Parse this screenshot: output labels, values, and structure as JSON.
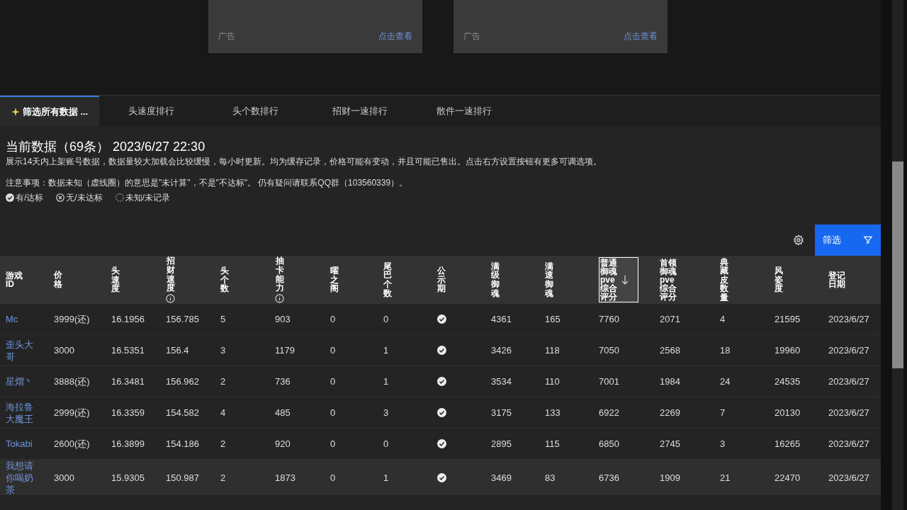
{
  "ads": [
    {
      "label": "广告",
      "link": "点击查看"
    },
    {
      "label": "广告",
      "link": "点击查看"
    }
  ],
  "tabs": [
    {
      "label": "筛选所有数据 ...",
      "selected": true,
      "icon": true
    },
    {
      "label": "头速度排行",
      "selected": false,
      "icon": false
    },
    {
      "label": "头个数排行",
      "selected": false,
      "icon": false
    },
    {
      "label": "招财一速排行",
      "selected": false,
      "icon": false
    },
    {
      "label": "散件一速排行",
      "selected": false,
      "icon": false
    }
  ],
  "heading": "当前数据（69条） 2023/6/27 22:30",
  "description": "展示14天内上架账号数据，数据量较大加载会比较缓慢，每小时更新。均为缓存记录，价格可能有变动，并且可能已售出。点击右方设置按钮有更多可调选项。",
  "notice": "注意事项：数据未知（虚线圈）的意思是\"未计算\"，不是\"不达标\"。 仍有疑问请联系QQ群（103560339）。",
  "legend": [
    {
      "kind": "yes",
      "label": "有/达标"
    },
    {
      "kind": "no",
      "label": "无/未达标"
    },
    {
      "kind": "unknown",
      "label": "未知/未记录"
    }
  ],
  "filter_button": "筛选",
  "table": {
    "columns": [
      {
        "label": "游戏ID",
        "kind": "wrapped",
        "info": false,
        "sorted": false
      },
      {
        "label": "价格",
        "kind": "stacked",
        "info": false,
        "sorted": false
      },
      {
        "label": "头速度",
        "kind": "stacked",
        "info": false,
        "sorted": false
      },
      {
        "label": "招财速度",
        "kind": "stacked",
        "info": true,
        "sorted": false
      },
      {
        "label": "头个数",
        "kind": "stacked",
        "info": false,
        "sorted": false
      },
      {
        "label": "抽卡能力",
        "kind": "stacked",
        "info": true,
        "sorted": false
      },
      {
        "label": "曜之阁",
        "kind": "stacked",
        "info": false,
        "sorted": false
      },
      {
        "label": "尾巴个数",
        "kind": "stacked",
        "info": false,
        "sorted": false
      },
      {
        "label": "公示期",
        "kind": "stacked",
        "info": false,
        "sorted": false
      },
      {
        "label": "满级御魂",
        "kind": "stacked",
        "info": false,
        "sorted": false
      },
      {
        "label": "满速御魂",
        "kind": "stacked",
        "info": false,
        "sorted": false
      },
      {
        "label": "普通御魂pve综合评分",
        "kind": "wrapped",
        "info": false,
        "sorted": true
      },
      {
        "label": "首领御魂pve综合评分",
        "kind": "wrapped",
        "info": false,
        "sorted": false
      },
      {
        "label": "典藏皮数量",
        "kind": "stacked",
        "info": false,
        "sorted": false
      },
      {
        "label": "风姿度",
        "kind": "stacked",
        "info": false,
        "sorted": false
      },
      {
        "label": "登记日期",
        "kind": "wrapped",
        "info": false,
        "sorted": false
      }
    ],
    "rows": [
      {
        "highlighted": false,
        "cells": [
          "Mc",
          "3999(还)",
          "16.1956",
          "156.785",
          "5",
          "903",
          "0",
          "0",
          {
            "kind": "check",
            "checked": true
          },
          "4361",
          "165",
          "7760",
          "2071",
          "4",
          "21595",
          "2023/6/27"
        ]
      },
      {
        "highlighted": false,
        "cells": [
          "歪头大哥",
          "3000",
          "16.5351",
          "156.4",
          "3",
          "1179",
          "0",
          "1",
          {
            "kind": "check",
            "checked": true
          },
          "3426",
          "118",
          "7050",
          "2568",
          "18",
          "19960",
          "2023/6/27"
        ]
      },
      {
        "highlighted": false,
        "cells": [
          "星熠丶",
          "3888(还)",
          "16.3481",
          "156.962",
          "2",
          "736",
          "0",
          "1",
          {
            "kind": "check",
            "checked": true
          },
          "3534",
          "110",
          "7001",
          "1984",
          "24",
          "24535",
          "2023/6/27"
        ]
      },
      {
        "highlighted": false,
        "cells": [
          "海拉鲁大魔王",
          "2999(还)",
          "16.3359",
          "154.582",
          "4",
          "485",
          "0",
          "3",
          {
            "kind": "check",
            "checked": true
          },
          "3175",
          "133",
          "6922",
          "2269",
          "7",
          "20130",
          "2023/6/27"
        ]
      },
      {
        "highlighted": false,
        "cells": [
          "Tokabi",
          "2600(还)",
          "16.3899",
          "154.186",
          "2",
          "920",
          "0",
          "0",
          {
            "kind": "check",
            "checked": true
          },
          "2895",
          "115",
          "6850",
          "2745",
          "3",
          "16265",
          "2023/6/27"
        ]
      },
      {
        "highlighted": true,
        "cells": [
          "我想请你喝奶茶",
          "3000",
          "15.9305",
          "150.987",
          "2",
          "1873",
          "0",
          "1",
          {
            "kind": "check",
            "checked": true
          },
          "3469",
          "83",
          "6736",
          "1909",
          "21",
          "22470",
          "2023/6/27"
        ]
      }
    ]
  }
}
